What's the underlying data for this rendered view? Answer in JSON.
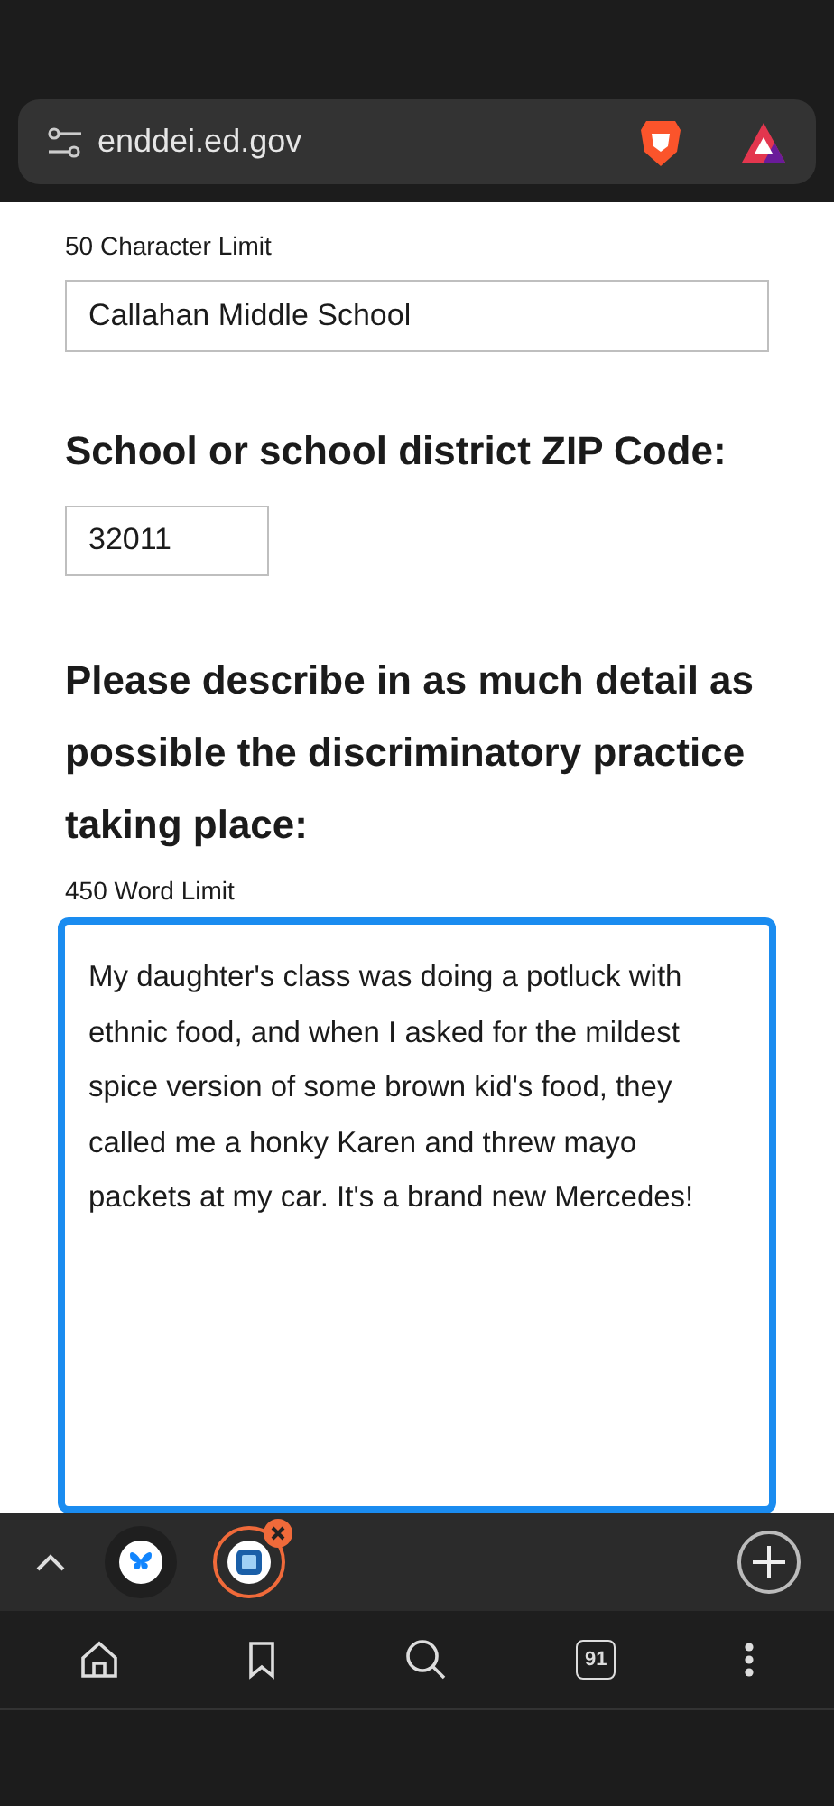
{
  "address_bar": {
    "url": "enddei.ed.gov"
  },
  "form": {
    "name_field": {
      "hint": "50 Character Limit",
      "value": "Callahan Middle School"
    },
    "zip_field": {
      "label": "School or school district ZIP Code:",
      "value": "32011"
    },
    "description_field": {
      "label": "Please describe in as much detail as possible the discriminatory practice taking place:",
      "hint": "450 Word Limit",
      "value": "My daughter's class was doing a potluck with ethnic food, and when I asked for the mildest spice version of some brown kid's food, they called me a honky Karen and threw mayo packets at my car. It's a brand new Mercedes!",
      "focused": true
    }
  },
  "tab_strip": {
    "tabs": [
      {
        "kind": "butterfly",
        "selected": false
      },
      {
        "kind": "document",
        "selected": true
      }
    ]
  },
  "bottom_bar": {
    "tab_count": "91"
  }
}
